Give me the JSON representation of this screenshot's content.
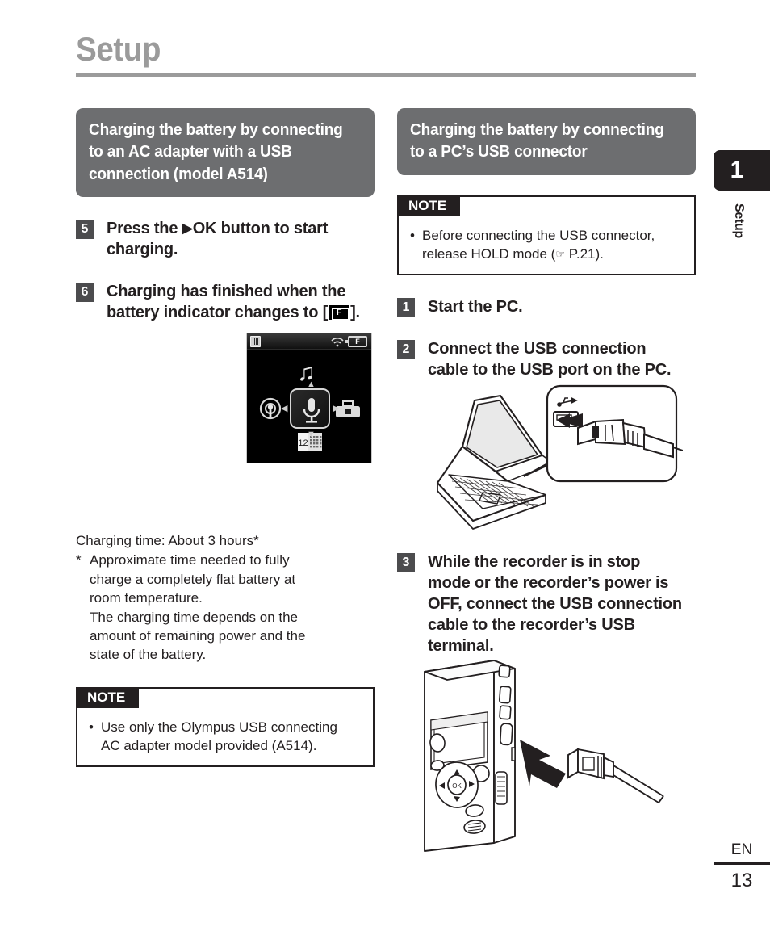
{
  "page": {
    "title": "Setup",
    "chapter_number": "1",
    "chapter_label": "Setup",
    "language_code": "EN",
    "page_number": "13"
  },
  "left_column": {
    "section_heading": {
      "line1": "Charging the battery by connecting",
      "line2": "to an AC adapter with a USB",
      "line3": "connection (model A514)"
    },
    "steps": [
      {
        "number": "5",
        "line1_a": "Press the ",
        "line1_play": "▶",
        "line1_b": "OK button to start",
        "line2": "charging."
      },
      {
        "number": "6",
        "line1": "Charging has finished when the",
        "line2_a": "battery indicator changes to [",
        "line2_icon": "battery-full-icon",
        "line2_b": "].",
        "icon_letter": "F"
      }
    ],
    "device_screen": {
      "status_card_icon": "memory-card-icon",
      "status_signal_icon": "wireless-signal-icon",
      "status_battery_label": "F",
      "menu_icons": [
        "music-note-icon",
        "microphone-icon",
        "radio-icon",
        "toolbox-icon",
        "calendar-icon"
      ],
      "calendar_day": "12"
    },
    "charging_time": "Charging time: About 3 hours*",
    "footnote": {
      "marker": "*",
      "lines": [
        "Approximate time needed to fully",
        "charge a completely flat battery at",
        "room temperature.",
        "The charging time depends on the",
        "amount of remaining power and the",
        "state of the battery."
      ]
    },
    "note": {
      "tag": "NOTE",
      "bullet": "•",
      "lines": [
        "Use only the Olympus USB connecting",
        "AC adapter model provided (A514)."
      ]
    }
  },
  "right_column": {
    "section_heading": {
      "line1": "Charging the battery by connecting",
      "line2": "to a PC’s USB connector"
    },
    "note": {
      "tag": "NOTE",
      "bullet": "•",
      "line1": "Before connecting the USB connector,",
      "line2_a": "release HOLD mode (",
      "line2_hand": "☞",
      "line2_b": " P.21)."
    },
    "steps": [
      {
        "number": "1",
        "line1": "Start the PC."
      },
      {
        "number": "2",
        "line1": "Connect the USB connection",
        "line2": "cable to the USB port on the PC."
      },
      {
        "number": "3",
        "line1": "While the recorder is in stop",
        "line2": "mode or the recorder’s power is",
        "line3": "OFF, connect the USB connection",
        "line4": "cable to the recorder’s USB",
        "line5": "terminal."
      }
    ],
    "illustrations": [
      "laptop-usb-port-illustration",
      "recorder-usb-terminal-illustration"
    ]
  },
  "colors": {
    "section_header_bg": "#6d6e70",
    "title_gray": "#9b9b9b",
    "step_number_bg": "#4c4c4e",
    "note_border": "#231f20",
    "text": "#231f20"
  }
}
